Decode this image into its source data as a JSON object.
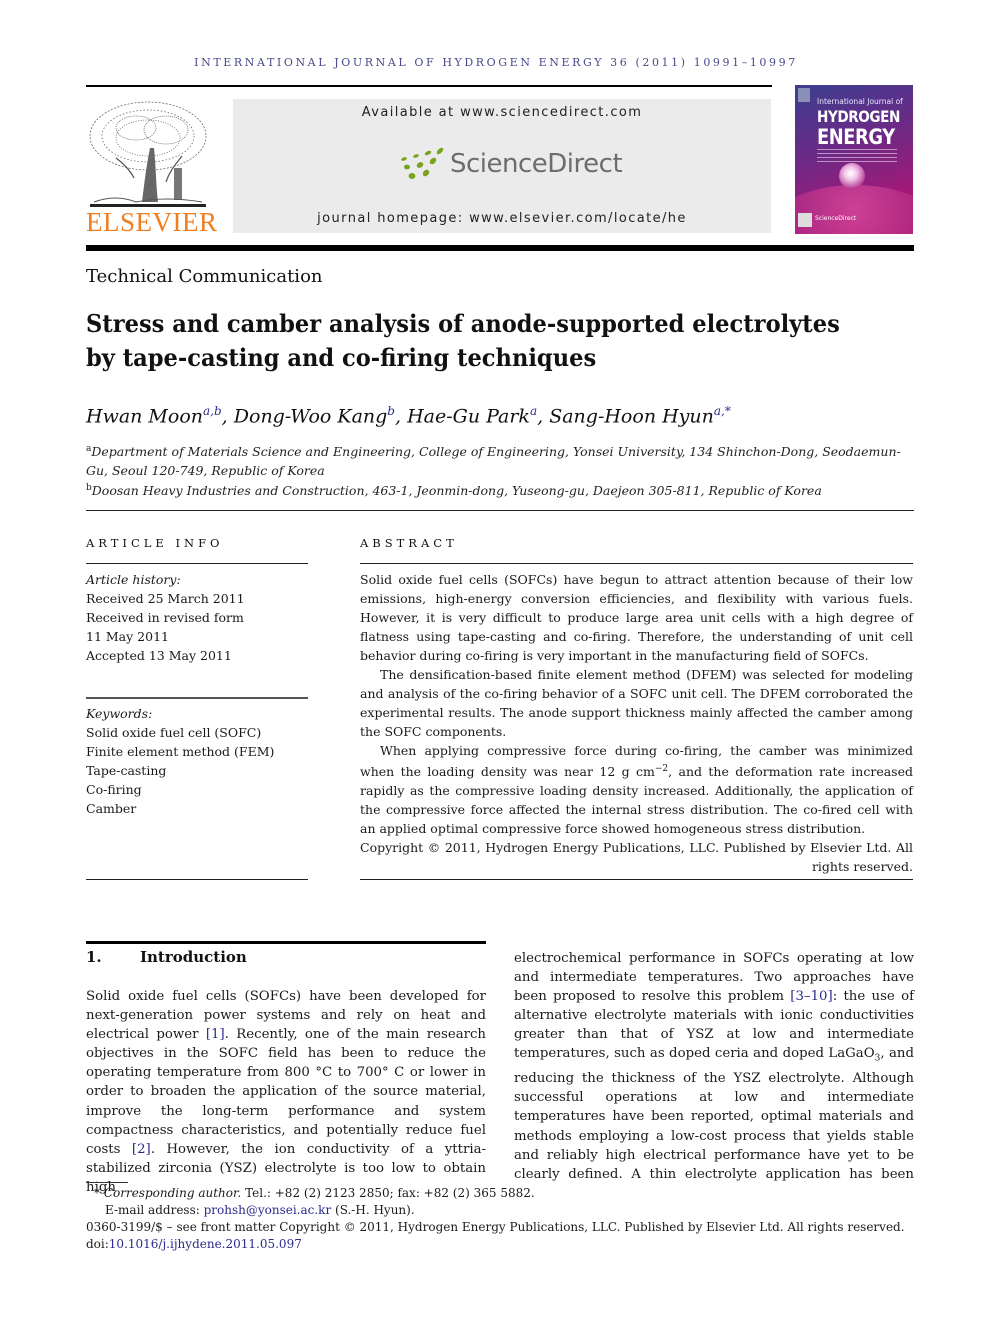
{
  "journal": {
    "running_head": "INTERNATIONAL JOURNAL OF HYDROGEN ENERGY 36 (2011) 10991–10997",
    "publisher_logo_text": "ELSEVIER",
    "available_at": "Available at www.sciencedirect.com",
    "sciencedirect_logo_text": "ScienceDirect",
    "homepage": "journal homepage: www.elsevier.com/locate/he",
    "cover": {
      "line1": "International Journal of",
      "line2": "HYDROGEN",
      "line3": "ENERGY",
      "footer": "ScienceDirect"
    },
    "colors": {
      "elsevier_orange": "#f07d1e",
      "sd_green": "#7aa21e",
      "link_blue": "#2b2b8c",
      "running_head": "#4a4a8a"
    }
  },
  "article": {
    "section_type": "Technical Communication",
    "title_line1": "Stress and camber analysis of anode-supported electrolytes",
    "title_line2": "by tape-casting and co-firing techniques",
    "authors": [
      {
        "name": "Hwan Moon",
        "sup": "a,b",
        "sep": ", "
      },
      {
        "name": "Dong-Woo Kang",
        "sup": "b",
        "sep": ", "
      },
      {
        "name": "Hae-Gu Park",
        "sup": "a",
        "sep": ", "
      },
      {
        "name": "Sang-Hoon Hyun",
        "sup": "a,*",
        "sep": ""
      }
    ],
    "affiliations": [
      {
        "mark": "a",
        "text": "Department of Materials Science and Engineering, College of Engineering, Yonsei University, 134 Shinchon-Dong, Seodaemun-Gu, Seoul 120-749, Republic of Korea"
      },
      {
        "mark": "b",
        "text": "Doosan Heavy Industries and Construction, 463-1, Jeonmin-dong, Yuseong-gu, Daejeon 305-811, Republic of Korea"
      }
    ]
  },
  "article_info": {
    "heading": "ARTICLE INFO",
    "history_label": "Article history:",
    "history": [
      "Received 25 March 2011",
      "Received in revised form",
      "11 May 2011",
      "Accepted 13 May 2011"
    ],
    "keywords_label": "Keywords:",
    "keywords": [
      "Solid oxide fuel cell (SOFC)",
      "Finite element method (FEM)",
      "Tape-casting",
      "Co-firing",
      "Camber"
    ]
  },
  "abstract": {
    "heading": "ABSTRACT",
    "p1": "Solid oxide fuel cells (SOFCs) have begun to attract attention because of their low emissions, high-energy conversion efficiencies, and flexibility with various fuels. However, it is very difficult to produce large area unit cells with a high degree of flatness using tape-casting and co-firing. Therefore, the understanding of unit cell behavior during co-firing is very important in the manufacturing field of SOFCs.",
    "p2": "The densification-based finite element method (DFEM) was selected for modeling and analysis of the co-firing behavior of a SOFC unit cell. The DFEM corroborated the experimental results. The anode support thickness mainly affected the camber among the SOFC components.",
    "p3_a": "When applying compressive force during co-firing, the camber was minimized when the loading density was near 12 g cm",
    "p3_sup": "−2",
    "p3_b": ", and the deformation rate increased rapidly as the compressive loading density increased. Additionally, the application of the compressive force affected the internal stress distribution. The co-fired cell with an applied optimal compressive force showed homogeneous stress distribution.",
    "copyright": "Copyright © 2011, Hydrogen Energy Publications, LLC. Published by Elsevier Ltd. All rights reserved."
  },
  "introduction": {
    "number": "1.",
    "heading": "Introduction",
    "left": {
      "t1": "Solid oxide fuel cells (SOFCs) have been developed for next-generation power systems and rely on heat and electrical power ",
      "r1": "[1]",
      "t2": ". Recently, one of the main research objectives in the SOFC field has been to reduce the operating temperature from 800 °C to 700° C or lower in order to broaden the application of the source material, improve the long-term performance and system compactness characteristics, and potentially reduce fuel costs ",
      "r2": "[2]",
      "t3": ". However, the ion conductivity of a yttria-stabilized zirconia (YSZ) electrolyte is too low to obtain high"
    },
    "right": {
      "t1": "electrochemical performance in SOFCs operating at low and intermediate temperatures. Two approaches have been proposed to resolve this problem ",
      "r1": "[3–10]",
      "t2": ": the use of alternative electrolyte materials with ionic conductivities greater than that of YSZ at low and intermediate temperatures, such as doped ceria and doped LaGaO",
      "sub": "3",
      "t3": ", and reducing the thickness of the YSZ electrolyte. Although successful operations at low and intermediate temperatures have been reported, optimal materials and methods employing a low-cost process that yields stable and reliably high electrical performance have yet to be clearly defined. A thin electrolyte application has been"
    }
  },
  "footnotes": {
    "star": "*",
    "corresponding_label": "Corresponding author.",
    "contact": " Tel.: +82 (2) 2123 2850; fax: +82 (2) 365 5882.",
    "email_label": "E-mail address: ",
    "email": "prohsh@yonsei.ac.kr",
    "email_suffix": " (S.-H. Hyun).",
    "issn_line": "0360-3199/$ – see front matter Copyright © 2011, Hydrogen Energy Publications, LLC. Published by Elsevier Ltd. All rights reserved.",
    "doi_label": "doi:",
    "doi": "10.1016/j.ijhydene.2011.05.097"
  }
}
